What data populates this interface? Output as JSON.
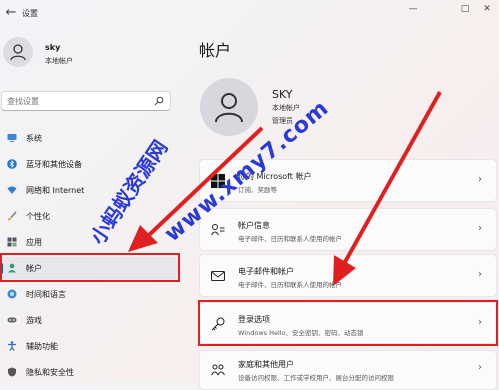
{
  "window": {
    "title": "设置",
    "back_icon": "back-arrow-icon",
    "controls": [
      "minimize-icon",
      "maximize-icon",
      "close-icon"
    ]
  },
  "user": {
    "name": "sky",
    "role": "本地帐户"
  },
  "search": {
    "placeholder": "查找设置"
  },
  "sidebar": {
    "items": [
      {
        "label": "系统",
        "icon": "monitor-icon"
      },
      {
        "label": "蓝牙和其他设备",
        "icon": "bluetooth-icon"
      },
      {
        "label": "网络和 Internet",
        "icon": "wifi-icon"
      },
      {
        "label": "个性化",
        "icon": "brush-icon"
      },
      {
        "label": "应用",
        "icon": "apps-icon"
      },
      {
        "label": "帐户",
        "icon": "person-icon",
        "active": true
      },
      {
        "label": "时间和语言",
        "icon": "globe-clock-icon"
      },
      {
        "label": "游戏",
        "icon": "gamepad-icon"
      },
      {
        "label": "辅助功能",
        "icon": "accessibility-icon"
      },
      {
        "label": "隐私和安全性",
        "icon": "shield-icon"
      }
    ]
  },
  "main": {
    "title": "帐户",
    "profile": {
      "name": "SKY",
      "type": "本地帐户",
      "role": "管理员"
    },
    "cards": [
      {
        "title": "你的 Microsoft 帐户",
        "desc": "订阅、奖励等",
        "icon": "windows-logo-icon"
      },
      {
        "title": "帐户信息",
        "desc": "电子邮件、日历和联系人使用的帐户",
        "icon": "account-info-icon"
      },
      {
        "title": "电子邮件和帐户",
        "desc": "电子邮件、日历和联系人使用的帐户",
        "icon": "mail-icon"
      },
      {
        "title": "登录选项",
        "desc": "Windows Hello、安全密钥、密码、动态锁",
        "icon": "key-icon"
      },
      {
        "title": "家庭和其他用户",
        "desc": "设备访问权限、工作或学校用户、展台分配的访问权限",
        "icon": "family-icon"
      }
    ]
  },
  "watermark": {
    "text_a": "小蚂蚁资源网",
    "text_b": "www.xmy7.com"
  },
  "colors": {
    "accent": "#0067c0",
    "annotation_red": "#e02020",
    "watermark_blue": "#2a3ad8"
  }
}
